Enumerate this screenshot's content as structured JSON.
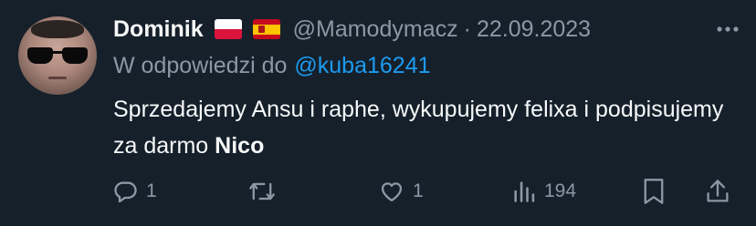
{
  "tweet": {
    "display_name": "Dominik",
    "flags": [
      "poland-flag-icon",
      "spain-flag-icon"
    ],
    "handle": "@Mamodymacz",
    "separator": "·",
    "date": "22.09.2023",
    "reply_prefix": "W odpowiedzi do",
    "reply_mention": "@kuba16241",
    "text_part1": "Sprzedajemy Ansu i raphe, wykupujemy felixa i podpisujemy za darmo ",
    "text_bold": "Nico",
    "actions": {
      "reply_count": "1",
      "retweet_count": "",
      "like_count": "1",
      "views_count": "194"
    }
  },
  "colors": {
    "background": "#15202b",
    "text_primary": "#f7f9f9",
    "text_secondary": "#8b98a5",
    "accent": "#1d9bf0"
  },
  "icons": {
    "more": "more-horizontal-icon",
    "reply": "reply-icon",
    "retweet": "retweet-icon",
    "like": "heart-icon",
    "views": "views-icon",
    "bookmark": "bookmark-icon",
    "share": "share-icon"
  }
}
